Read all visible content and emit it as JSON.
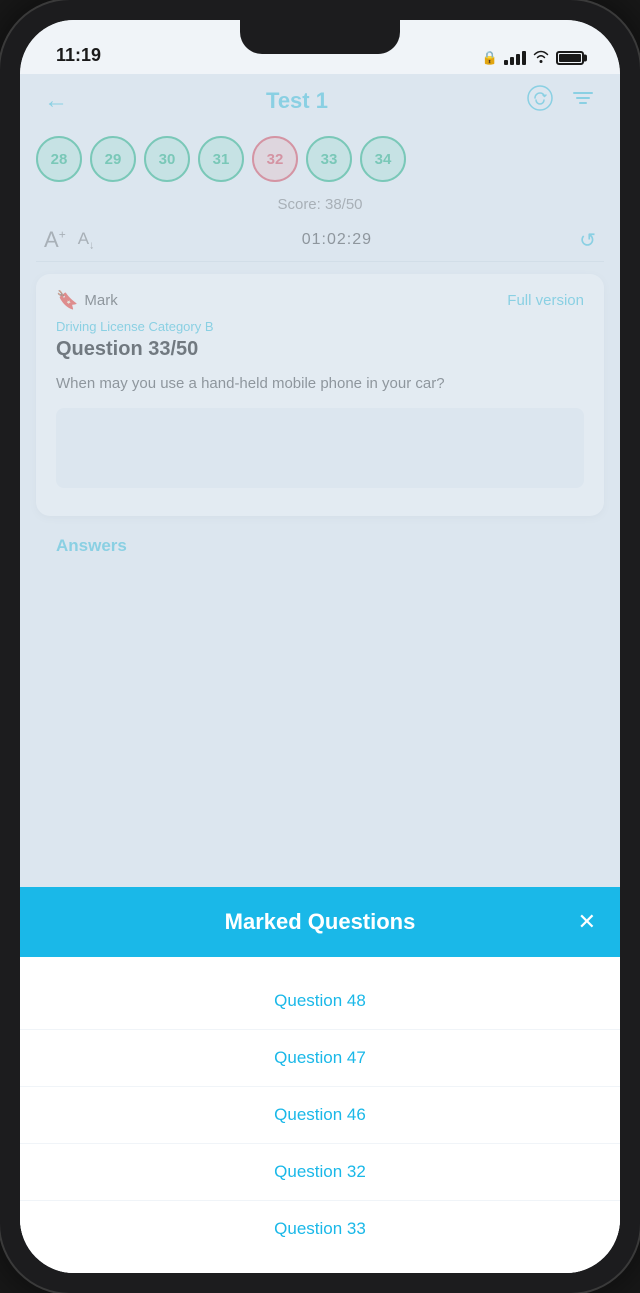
{
  "status_bar": {
    "time": "11:19",
    "lock_icon": "🔒"
  },
  "header": {
    "back_label": "←",
    "title": "Test 1",
    "cloud_icon": "☁",
    "settings_icon": "⚙"
  },
  "question_numbers": [
    {
      "num": "28",
      "state": "green"
    },
    {
      "num": "29",
      "state": "green"
    },
    {
      "num": "30",
      "state": "green"
    },
    {
      "num": "31",
      "state": "green"
    },
    {
      "num": "32",
      "state": "red"
    },
    {
      "num": "33",
      "state": "green"
    },
    {
      "num": "34",
      "state": "green"
    }
  ],
  "score": {
    "label": "Score: 38/50"
  },
  "controls": {
    "timer": "01:02:29",
    "font_up_label": "A",
    "font_down_label": "A",
    "refresh_icon": "↺"
  },
  "question_panel": {
    "mark_label": "Mark",
    "full_version_label": "Full version",
    "category": "Driving License Category B",
    "question_number": "Question 33/50",
    "question_text": "When may you use a hand-held mobile phone in your car?"
  },
  "answers_section": {
    "label": "Answers"
  },
  "modal": {
    "title": "Marked Questions",
    "close_label": "✕",
    "items": [
      {
        "label": "Question 48"
      },
      {
        "label": "Question 47"
      },
      {
        "label": "Question 46"
      },
      {
        "label": "Question 32"
      },
      {
        "label": "Question 33"
      }
    ]
  },
  "colors": {
    "accent": "#1ab8e8",
    "green": "#2db88a",
    "red": "#e05060"
  }
}
